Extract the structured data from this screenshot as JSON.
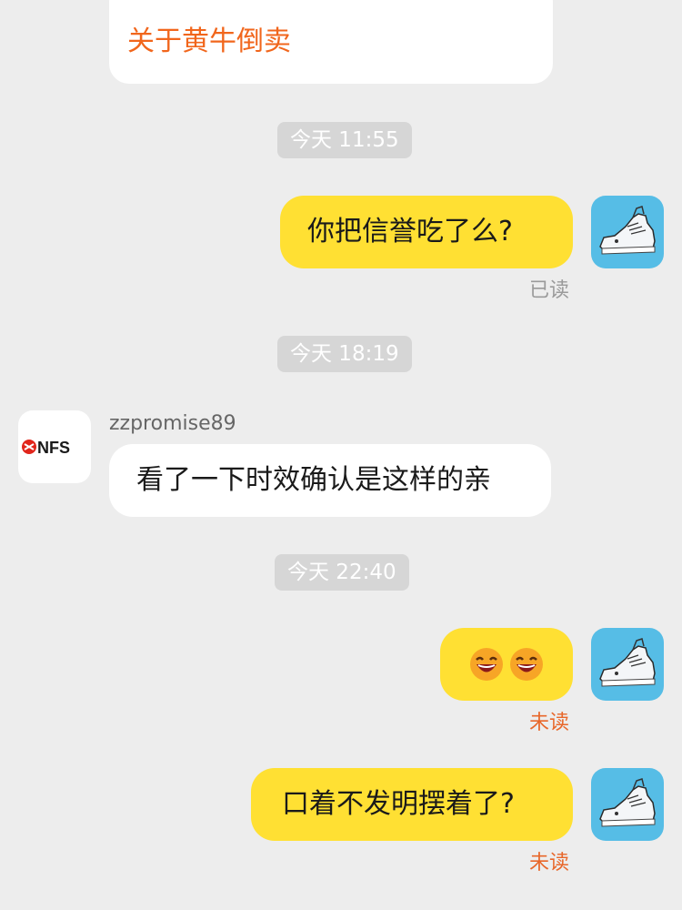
{
  "top_card": {
    "link_text": "关于黄牛倒卖"
  },
  "messages": [
    {
      "time": "今天 11:55",
      "text": "你把信誉吃了么?",
      "status": "已读"
    },
    {
      "time": "今天 18:19",
      "sender": "zzpromise89",
      "text": "看了一下时效确认是这样的亲",
      "avatar_logo": "NFS"
    },
    {
      "time": "今天 22:40",
      "emoji": [
        "laughing-face",
        "laughing-face"
      ],
      "status": "未读"
    },
    {
      "text": "口着不发明摆着了?",
      "status": "未读"
    }
  ],
  "colors": {
    "background": "#ededed",
    "my_bubble": "#ffe033",
    "their_bubble": "#ffffff",
    "time_pill": "#d6d6d6",
    "accent_orange": "#f1661c",
    "read_gray": "#9a9a9a",
    "unread_orange": "#e8672a",
    "shoe_avatar_bg": "#56bde6",
    "brand_red": "#e1251b"
  }
}
